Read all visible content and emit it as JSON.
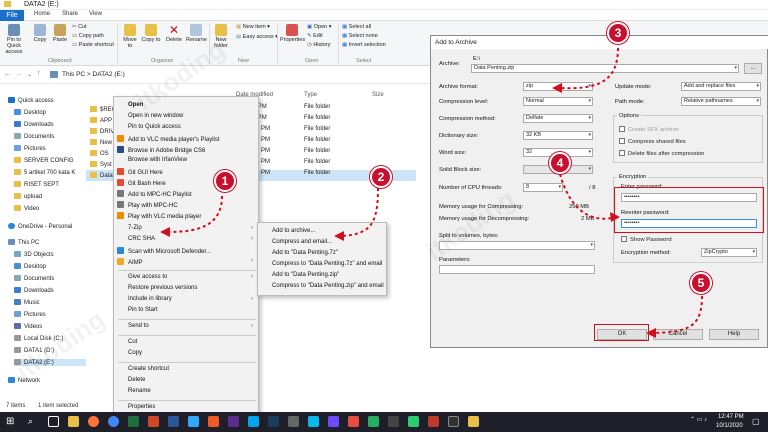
{
  "window": {
    "title": "DATA2 (E:)"
  },
  "tabs": [
    "File",
    "Home",
    "Share",
    "View"
  ],
  "ribbon": {
    "clipboard": {
      "pin": "Pin to Quick access",
      "copy": "Copy",
      "paste": "Paste",
      "cut": "Cut",
      "copy_path": "Copy path",
      "paste_shortcut": "Paste shortcut",
      "group": "Clipboard"
    },
    "organize": {
      "move_to": "Move to",
      "copy_to": "Copy to",
      "delete": "Delete",
      "rename": "Rename",
      "group": "Organize"
    },
    "new": {
      "new_folder": "New folder",
      "new_item": "New item",
      "easy_access": "Easy access",
      "group": "New"
    },
    "open": {
      "properties": "Properties",
      "open": "Open",
      "edit": "Edit",
      "history": "History",
      "group": "Open"
    },
    "select": {
      "select_all": "Select all",
      "select_none": "Select none",
      "invert": "Invert selection",
      "group": "Select"
    }
  },
  "address": {
    "path": "This PC  >  DATA2 (E:)"
  },
  "sidebar": {
    "items": [
      "Quick access",
      "Desktop",
      "Downloads",
      "Documents",
      "Pictures",
      "SERVER CONFIG",
      "5 artikel 700 kata K",
      "RISET SEPT",
      "upload",
      "Video",
      "OneDrive - Personal",
      "This PC",
      "3D Objects",
      "Desktop",
      "Documents",
      "Downloads",
      "Music",
      "Pictures",
      "Videos",
      "Local Disk (C:)",
      "DATA1 (D:)",
      "DATA2 (E:)",
      "Network"
    ]
  },
  "filelist": {
    "headers": {
      "date": "Date modified",
      "type": "Type",
      "size": "Size"
    },
    "rows": [
      {
        "name": "$REC",
        "date": "19 4:48 PM",
        "type": "File folder"
      },
      {
        "name": "APP",
        "date": "19 4:50 PM",
        "type": "File folder"
      },
      {
        "name": "DRIV",
        "date": "19 12:02 PM",
        "type": "File folder"
      },
      {
        "name": "New",
        "date": "20 10:03 PM",
        "type": "File folder"
      },
      {
        "name": "OS",
        "date": "20 12:33 PM",
        "type": "File folder"
      },
      {
        "name": "Syst",
        "date": "019 9:05 PM",
        "type": "File folder"
      },
      {
        "name": "Data",
        "date": "20 12:39 PM",
        "type": "File folder"
      }
    ]
  },
  "status": {
    "items": "7 items",
    "selected": "1 item selected"
  },
  "context_menu": {
    "items": [
      "Open",
      "Open in new window",
      "Pin to Quick access",
      "Add to VLC media player's Playlist",
      "Browse in Adobe Bridge CS6",
      "Browse with IrfanView",
      "Git GUI Here",
      "Git Bash Here",
      "Add to MPC-HC Playlist",
      "Play with MPC-HC",
      "Play with VLC media player",
      "7-Zip",
      "CRC SHA",
      "Scan with Microsoft Defender...",
      "AIMP",
      "Give access to",
      "Restore previous versions",
      "Include in library",
      "Pin to Start",
      "Send to",
      "Cut",
      "Copy",
      "Create shortcut",
      "Delete",
      "Rename",
      "Properties"
    ]
  },
  "submenu": {
    "items": [
      "Add to archive...",
      "Compress and email...",
      "Add to \"Data Penting.7z\"",
      "Compress to \"Data Penting.7z\" and email",
      "Add to \"Data Penting.zip\"",
      "Compress to \"Data Penting.zip\" and email"
    ]
  },
  "dialog": {
    "title": "Add to Archive",
    "archive_label": "Archive:",
    "archive_dir": "E:\\",
    "archive_name": "Data Penting.zip",
    "browse": "...",
    "format_label": "Archive format:",
    "format": "zip",
    "level_label": "Compression level:",
    "level": "Normal",
    "method_label": "Compression method:",
    "method": "Deflate",
    "dict_label": "Dictionary size:",
    "dict": "32 KB",
    "word_label": "Word size:",
    "word": "32",
    "solid_label": "Solid Block size:",
    "threads_label": "Number of CPU threads:",
    "threads": "8",
    "threads_total": "/ 8",
    "mem_comp_label": "Memory usage for Compressing:",
    "mem_comp": "259 MB",
    "mem_decomp_label": "Memory usage for Decompressing:",
    "mem_decomp": "2 MB",
    "split_label": "Split to volumes, bytes:",
    "params_label": "Parameters:",
    "update_label": "Update mode:",
    "update": "Add and replace files",
    "pathmode_label": "Path mode:",
    "pathmode": "Relative pathnames",
    "options_label": "Options",
    "sfx": "Create SFX archive",
    "shared": "Compress shared files",
    "delete_after": "Delete files after compression",
    "encryption_label": "Encryption",
    "enter_pw": "Enter password:",
    "pw1": "••••••••",
    "reenter_pw": "Reenter password:",
    "pw2": "••••••••",
    "show_pw": "Show Password",
    "enc_method_label": "Encryption method:",
    "enc_method": "ZipCrypto",
    "ok": "OK",
    "cancel": "Cancel",
    "help": "Help"
  },
  "badges": [
    "1",
    "2",
    "3",
    "4",
    "5"
  ],
  "watermark": "itkoding",
  "taskbar": {
    "time": "12:47 PM",
    "date": "10/1/2020"
  },
  "colors": {
    "accent": "#1a6fc9",
    "highlight": "#d0101c",
    "folder": "#e8c048"
  }
}
